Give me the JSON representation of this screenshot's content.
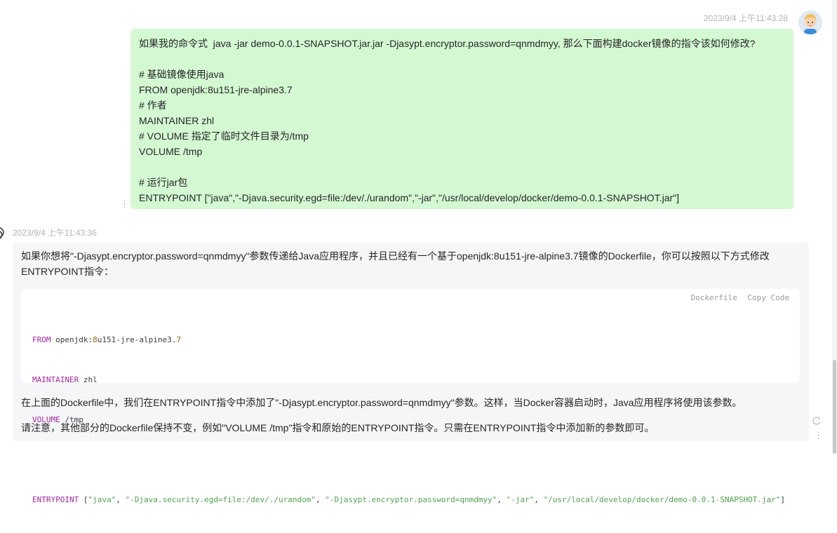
{
  "user_message": {
    "timestamp": "2023/9/4 上午11:43:28",
    "avatar": "user-avatar",
    "lines": [
      "如果我的命令式  java -jar demo-0.0.1-SNAPSHOT.jar.jar -Djasypt.encryptor.password=qnmdmyy, 那么下面构建docker镜像的指令该如何修改?",
      "",
      "# 基础镜像使用java",
      "FROM openjdk:8u151-jre-alpine3.7",
      "# 作者",
      "MAINTAINER zhl",
      "# VOLUME 指定了临时文件目录为/tmp",
      "VOLUME /tmp",
      "",
      "# 运行jar包",
      "ENTRYPOINT [\"java\",\"-Djava.security.egd=file:/dev/./urandom\",\"-jar\",\"/usr/local/develop/docker/demo-0.0.1-SNAPSHOT.jar\"]"
    ]
  },
  "assistant_message": {
    "timestamp": "2023/9/4 上午11:43:36",
    "intro_line1": "如果你想将\"-Djasypt.encryptor.password=qnmdmyy\"参数传递给Java应用程序，并且已经有一个基于openjdk:8u151-jre-alpine3.7镜像的Dockerfile，你可以按照以下方式修改",
    "intro_line2": "ENTRYPOINT指令：",
    "code": {
      "language": "Dockerfile",
      "copy_label": "Copy Code",
      "line1": {
        "kw": "FROM",
        "rest_a": " openjdk:",
        "num": "8",
        "rest_b": "u151-jre-alpine3.",
        "num2": "7"
      },
      "line2": {
        "kw": "MAINTAINER",
        "rest": " zhl"
      },
      "line3": {
        "kw": "VOLUME",
        "rest": " /tmp"
      },
      "line5": {
        "kw": "ENTRYPOINT",
        "open": " [",
        "s1": "\"java\"",
        "s2": "\"-Djava.security.egd=file:/dev/./urandom\"",
        "s3": "\"-Djasypt.encryptor.password=qnmdmyy\"",
        "s4": "\"-jar\"",
        "s5": "\"/usr/local/develop/docker/demo-0.0.1-SNAPSHOT.jar\"",
        "sep": ", ",
        "close": "]"
      }
    },
    "paragraph2": "在上面的Dockerfile中，我们在ENTRYPOINT指令中添加了\"-Djasypt.encryptor.password=qnmdmyy\"参数。这样，当Docker容器启动时，Java应用程序将使用该参数。",
    "paragraph3": "请注意，其他部分的Dockerfile保持不变，例如\"VOLUME /tmp\"指令和原始的ENTRYPOINT指令。只需在ENTRYPOINT指令中添加新的参数即可。"
  },
  "icons": {
    "more": "⋮",
    "assistant": "openai-logo-icon",
    "refresh": "refresh-icon"
  }
}
